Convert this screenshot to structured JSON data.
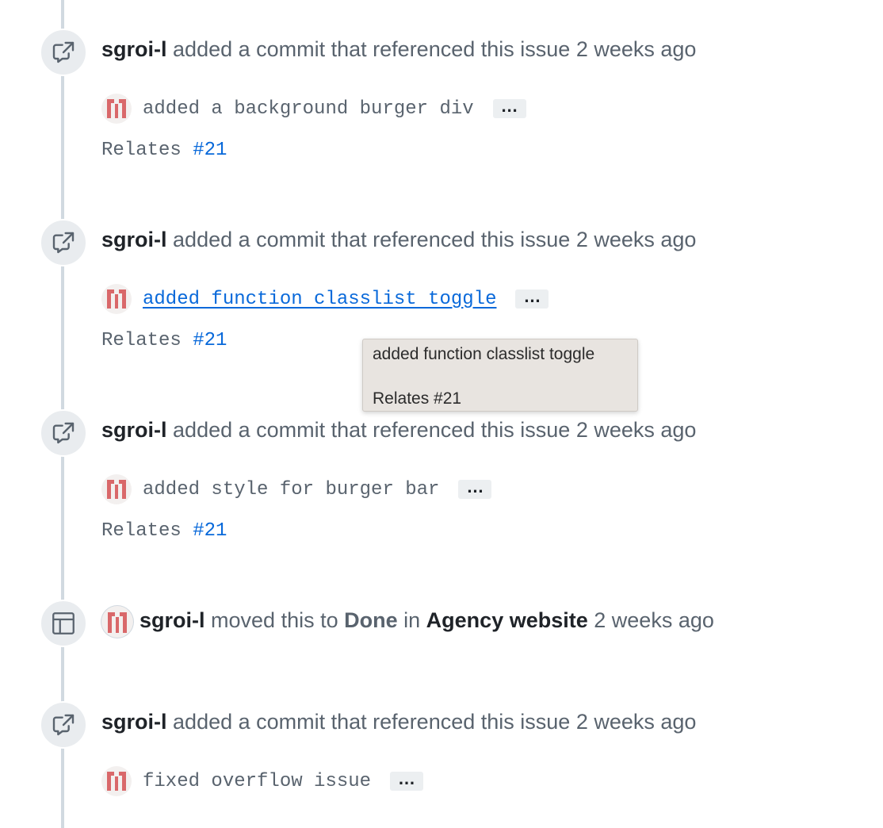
{
  "events": [
    {
      "kind": "commit-reference",
      "author": "sgroi-l",
      "action": "added a commit that referenced this issue",
      "time": "2 weeks ago",
      "commit_message": "added a background burger div",
      "ellipsis": "…",
      "relates_prefix": "Relates",
      "relates_issue": "#21"
    },
    {
      "kind": "commit-reference",
      "author": "sgroi-l",
      "action": "added a commit that referenced this issue",
      "time": "2 weeks ago",
      "commit_message": "added function classlist toggle",
      "ellipsis": "…",
      "relates_prefix": "Relates",
      "relates_issue": "#21"
    },
    {
      "kind": "commit-reference",
      "author": "sgroi-l",
      "action": "added a commit that referenced this issue",
      "time": "2 weeks ago",
      "commit_message": "added style for burger bar",
      "ellipsis": "…",
      "relates_prefix": "Relates",
      "relates_issue": "#21"
    },
    {
      "kind": "project-move",
      "author": "sgroi-l",
      "action_moved": "moved this to",
      "status": "Done",
      "action_in": "in",
      "project": "Agency website",
      "time": "2 weeks ago"
    },
    {
      "kind": "commit-reference",
      "author": "sgroi-l",
      "action": "added a commit that referenced this issue",
      "time": "2 weeks ago",
      "commit_message": "fixed overflow issue",
      "ellipsis": "…"
    }
  ],
  "tooltip": {
    "line1": "added function classlist toggle",
    "line2": "Relates #21"
  },
  "colors": {
    "link": "#0969da",
    "text_muted": "#59636e",
    "text_strong": "#1f2328",
    "timeline": "#d1d9e0",
    "badge_bg": "#e9ecef",
    "avatar_red": "#d9686a"
  },
  "icons": {
    "commit_reference": "cross-reference-icon",
    "project_move": "project-table-icon"
  }
}
